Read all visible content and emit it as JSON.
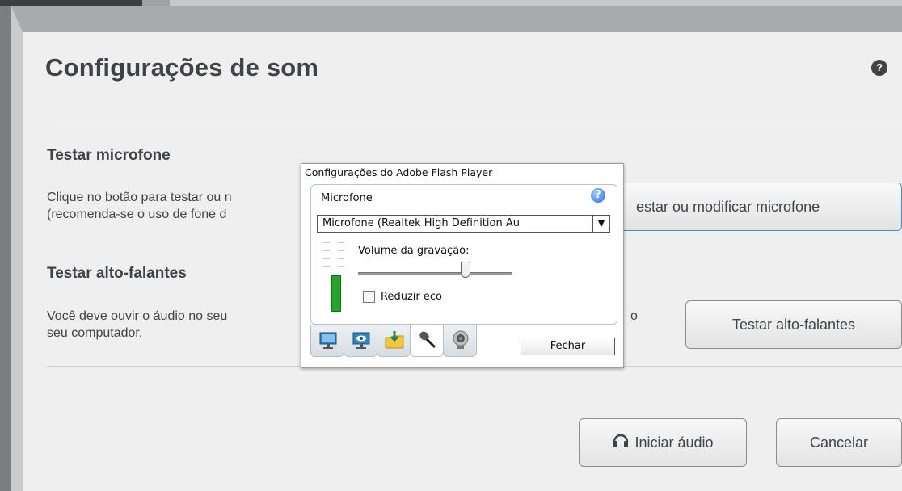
{
  "dialog": {
    "title": "Configurações de som",
    "help_icon": "?",
    "mic_section": {
      "heading": "Testar microfone",
      "line1": "Clique no botão para testar ou n",
      "line2": "(recomenda-se o uso de fone d",
      "button": "estar ou modificar microfone"
    },
    "speaker_section": {
      "heading": "Testar alto-falantes",
      "line1": "Você deve ouvir o áudio no seu",
      "line1_tail": "o",
      "line2": "seu computador.",
      "button": "Testar alto-falantes"
    },
    "footer": {
      "start_button": "Iniciar áudio",
      "cancel_button": "Cancelar"
    }
  },
  "flash": {
    "title": "Configurações do Adobe Flash Player",
    "section_label": "Microfone",
    "help": "?",
    "device_selected": "Microfone (Realtek High Definition Au",
    "volume_label": "Volume da gravação:",
    "volume_level": 0.7,
    "echo_label": "Reduzir eco",
    "echo_checked": false,
    "close_button": "Fechar",
    "tabs": [
      "display-icon",
      "privacy-icon",
      "storage-icon",
      "microphone-icon",
      "camera-icon"
    ],
    "selected_tab": "microphone-icon"
  }
}
